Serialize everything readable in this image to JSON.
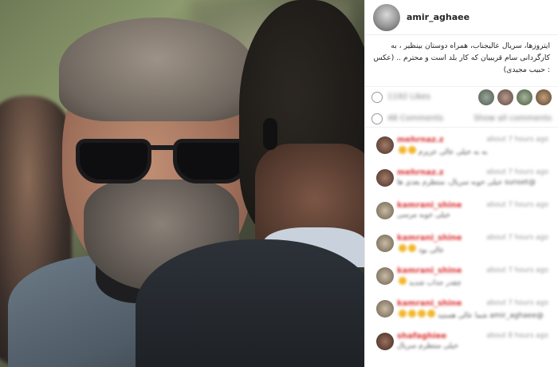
{
  "post": {
    "username": "amir_aghaee",
    "caption": "ایترو‌زها، سریال عالیجناب، همراه دوستان بینظیر ، به کارگردانی سام قریبیان که کار بلد است و محترم .. (عکس : حبیب مجیدی)"
  },
  "stats": {
    "likes_text": "1192 Likes",
    "comments_text": "48 Comments",
    "show_all": "Show all comments"
  },
  "comments": [
    {
      "user": "mehrnaz.z",
      "time": "about 7 hours ago",
      "text": "به به خیلی عالی عزیزم"
    },
    {
      "user": "mehrnaz.z",
      "time": "about 7 hours ago",
      "text": "@sunset خیلی خوبه سریال، منتظرم بعدی ها"
    },
    {
      "user": "kamrani_shine",
      "time": "about 7 hours ago",
      "text": "خیلی خوبه مرسی"
    },
    {
      "user": "kamrani_shine",
      "time": "about 7 hours ago",
      "text": "عالی بود"
    },
    {
      "user": "kamrani_shine",
      "time": "about 7 hours ago",
      "text": "چقدر جذاب شدید"
    },
    {
      "user": "kamrani_shine",
      "time": "about 7 hours ago",
      "text": "@amir_aghaee شما عالی هستید"
    },
    {
      "user": "shafaghiee",
      "time": "about 8 hours ago",
      "text": "خیلی منتظرم سریال"
    }
  ],
  "colors": {
    "username": "#262626",
    "comment_user": "#dd3333",
    "emoji": "#f2b72c"
  }
}
